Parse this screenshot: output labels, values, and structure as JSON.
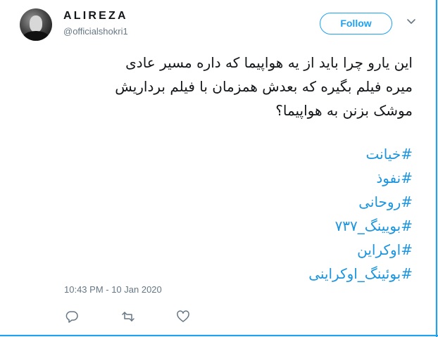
{
  "author": {
    "display_name": "ALIREZA",
    "handle": "@officialshokri1"
  },
  "follow_button": {
    "label": "Follow"
  },
  "tweet": {
    "lines": [
      "این یارو چرا باید از یه هواپیما که داره مسیر عادی",
      "میره فیلم بگیره که بعدش همزمان با فیلم برداریش",
      "موشک بزنن به هواپیما؟"
    ],
    "hashtags": [
      "#خیانت",
      "#نفوذ",
      "#روحانی",
      "#بویینگ_۷۳۷",
      "#اوکراین",
      "#بوئینگ_اوکراینی"
    ],
    "timestamp": "10:43 PM - 10 Jan 2020"
  },
  "actions": {
    "icons": [
      "reply-icon",
      "retweet-icon",
      "like-icon"
    ]
  },
  "colors": {
    "accent": "#1da1f2",
    "hashtag": "#1b95e0",
    "text": "#14171a",
    "muted": "#657786"
  }
}
